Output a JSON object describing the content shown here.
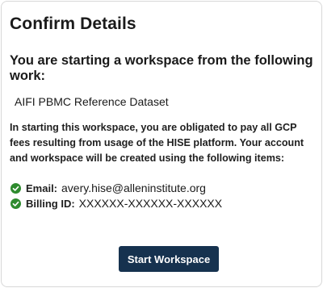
{
  "dialog": {
    "title": "Confirm Details",
    "subtitle": "You are starting a workspace from the following work:",
    "work_name": "AIFI PBMC Reference Dataset",
    "notice": "In starting this workspace, you are obligated to pay all GCP fees resulting from usage of the HISE platform. Your account and workspace will be created using the following items:",
    "items": [
      {
        "label": "Email:",
        "value": "avery.hise@alleninstitute.org",
        "icon": "check-circle-icon"
      },
      {
        "label": "Billing ID:",
        "value": "XXXXXX-XXXXXX-XXXXXX",
        "icon": "check-circle-icon"
      }
    ],
    "start_button_label": "Start Workspace"
  },
  "colors": {
    "check": "#2e8b2e",
    "button": "#16324f"
  }
}
